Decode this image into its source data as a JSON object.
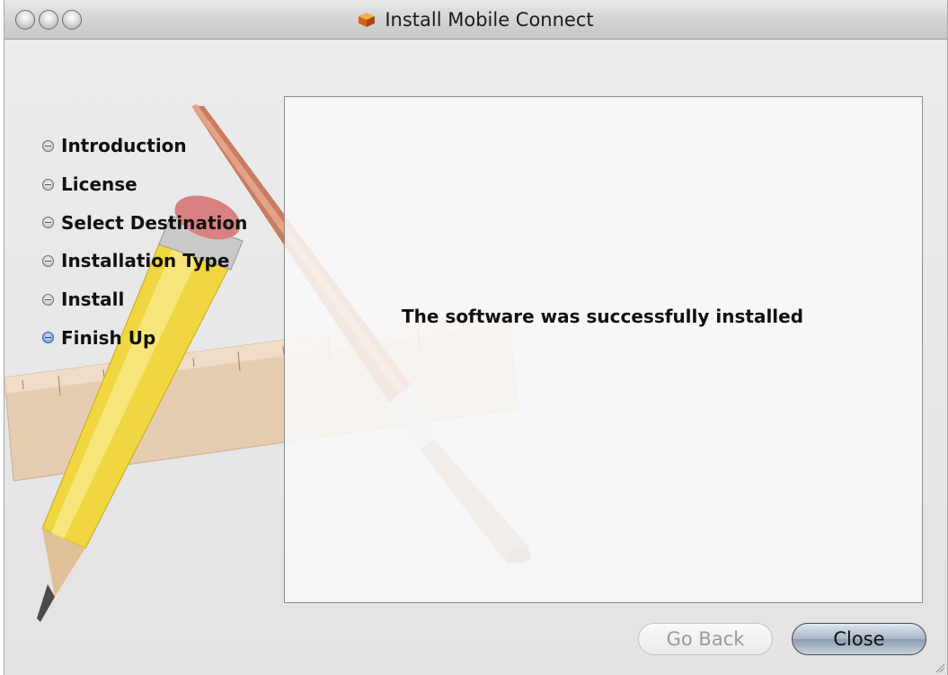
{
  "window": {
    "title": "Install Mobile Connect"
  },
  "sidebar": {
    "steps": [
      {
        "label": "Introduction",
        "state": "done"
      },
      {
        "label": "License",
        "state": "done"
      },
      {
        "label": "Select Destination",
        "state": "done"
      },
      {
        "label": "Installation Type",
        "state": "done"
      },
      {
        "label": "Install",
        "state": "done"
      },
      {
        "label": "Finish Up",
        "state": "current"
      }
    ]
  },
  "content": {
    "message": "The software was successfully installed"
  },
  "buttons": {
    "go_back": {
      "label": "Go Back",
      "enabled": false
    },
    "close": {
      "label": "Close",
      "enabled": true
    }
  },
  "colors": {
    "active_step_bullet": "#5a8fd2",
    "close_button": "#a8b6c6"
  },
  "icons": {
    "title_icon": "package-icon",
    "step_bullet": "step-bullet-icon"
  }
}
